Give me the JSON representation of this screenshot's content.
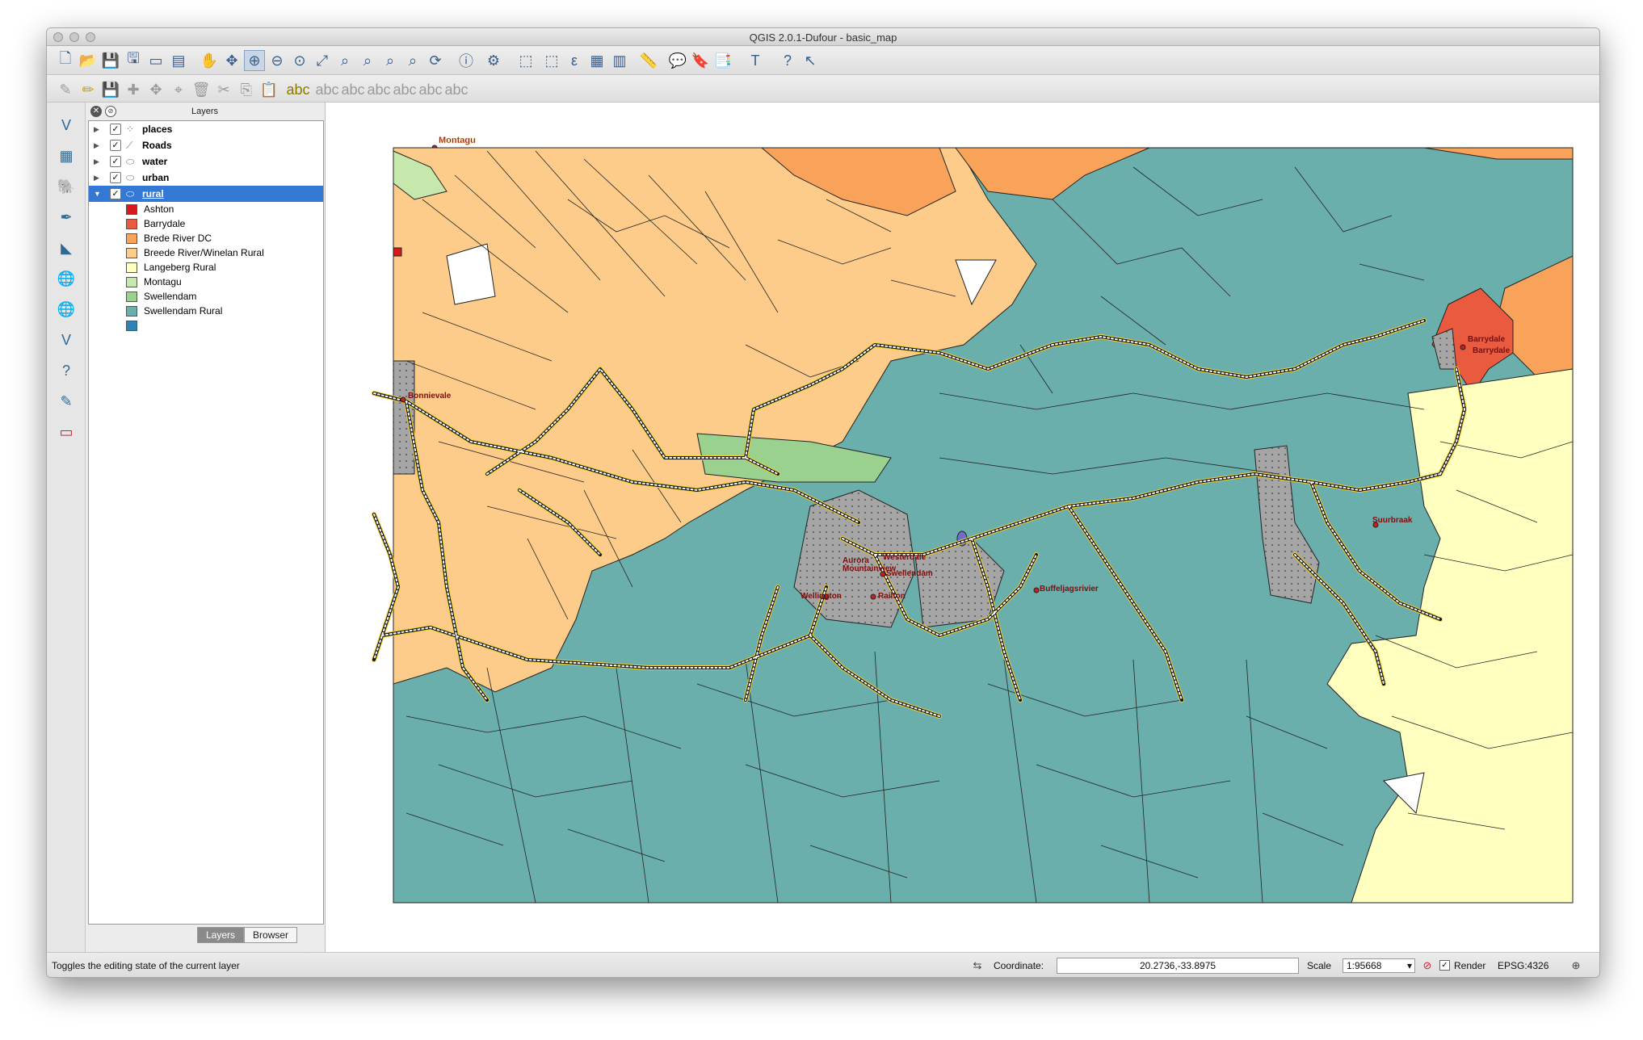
{
  "window": {
    "title": "QGIS 2.0.1-Dufour - basic_map"
  },
  "layers_panel": {
    "title": "Layers",
    "close_glyph": "✕",
    "float_glyph": "⊘",
    "layers": [
      {
        "name": "places",
        "icon": "point-layer-icon",
        "checked": "✓",
        "expand": "▶"
      },
      {
        "name": "Roads",
        "icon": "line-layer-icon",
        "checked": "✓",
        "expand": "▶"
      },
      {
        "name": "water",
        "icon": "polygon-layer-icon",
        "checked": "✓",
        "expand": "▶"
      },
      {
        "name": "urban",
        "icon": "polygon-layer-icon",
        "checked": "✓",
        "expand": "▶"
      },
      {
        "name": "rural",
        "icon": "polygon-layer-icon",
        "checked": "✓",
        "expand": "▼"
      }
    ],
    "legend": [
      {
        "label": "Ashton",
        "color": "#d7191c"
      },
      {
        "label": "Barrydale",
        "color": "#ea5a3f"
      },
      {
        "label": "Brede River DC",
        "color": "#f9a35a"
      },
      {
        "label": "Breede River/Winelan Rural",
        "color": "#fdcc8a"
      },
      {
        "label": "Langeberg Rural",
        "color": "#ffffc0"
      },
      {
        "label": "Montagu",
        "color": "#c7e8ad"
      },
      {
        "label": "Swellendam",
        "color": "#9ad18e"
      },
      {
        "label": "Swellendam Rural",
        "color": "#6aafab"
      },
      {
        "label": "",
        "color": "#2b83ba"
      }
    ],
    "tabs": [
      "Layers",
      "Browser"
    ]
  },
  "map": {
    "colors": {
      "rural_teal": "#6aafab",
      "breede_rural": "#fdcc8a",
      "brede_dc": "#f9a35a",
      "langeberg": "#ffffc0",
      "barrydale": "#ea5a3f",
      "ashton": "#d7191c",
      "montagu": "#c7e8ad",
      "swellendam": "#9ad18e",
      "urban_grey": "#a5a5a5",
      "road_yellow": "#f2d12a",
      "water_blue": "#6e6ec8"
    },
    "place_labels": [
      "Montagu",
      "Bonnievale",
      "Barrydale",
      "Barrydale",
      "Suurbraak",
      "Swellendam",
      "Buffeljagsrivier",
      "Railton",
      "Wellington",
      "Aurora",
      "Westerdale",
      "Mountainview"
    ]
  },
  "statusbar": {
    "message": "Toggles the editing state of the current layer",
    "coordinate_label": "Coordinate:",
    "coordinate_value": "20.2736,-33.8975",
    "scale_label": "Scale",
    "scale_value": "1:95668",
    "render_label": "Render",
    "render_checked": "✓",
    "crs": "EPSG:4326"
  }
}
